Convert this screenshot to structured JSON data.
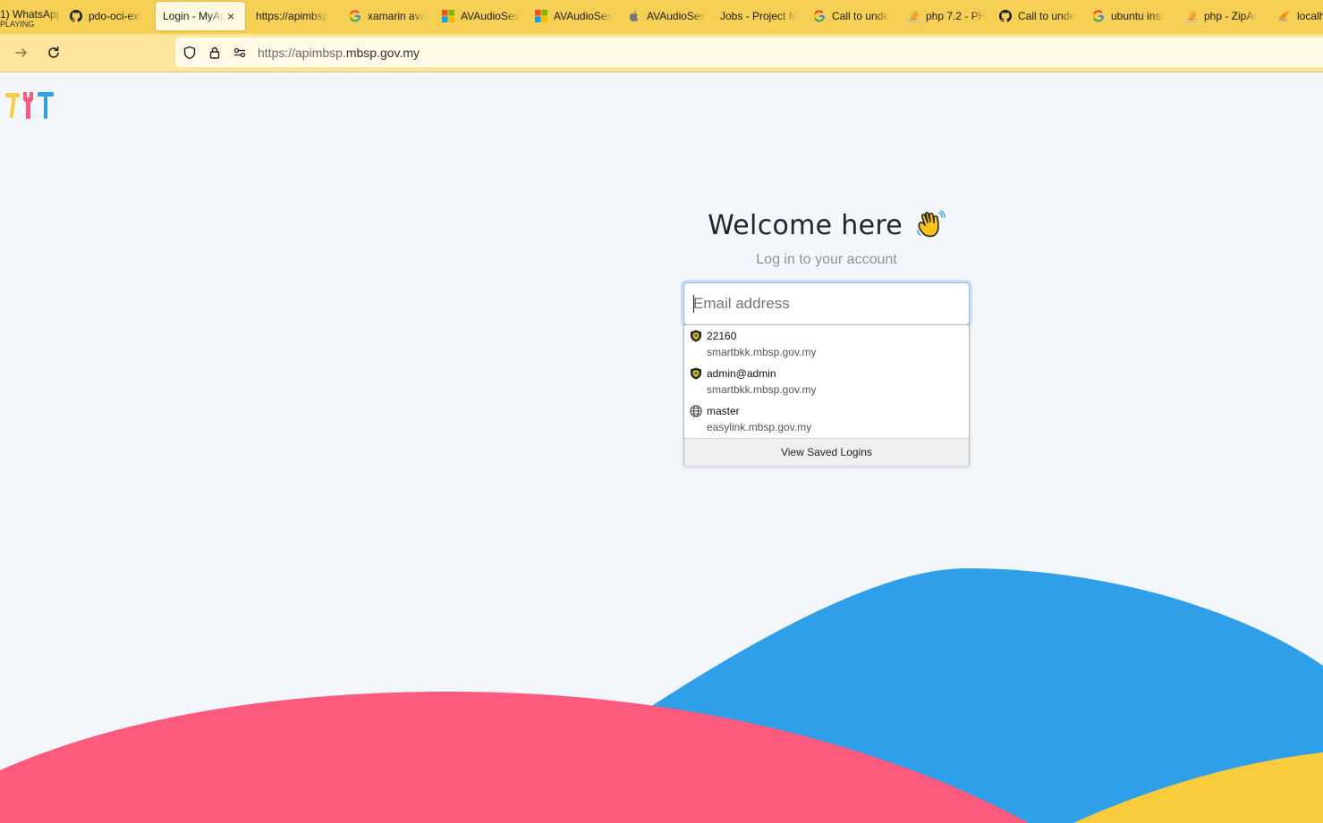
{
  "browser": {
    "tabs": [
      {
        "label": "1) WhatsApp",
        "sub": "PLAYING",
        "icon": "whatsapp-icon"
      },
      {
        "label": "pdo-oci-ext",
        "icon": "github-icon"
      },
      {
        "label": "Login - MyApi",
        "icon": "none",
        "active": true
      },
      {
        "label": "https://apimbsp",
        "icon": "none"
      },
      {
        "label": "xamarin ava",
        "icon": "google-icon"
      },
      {
        "label": "AVAudioSes",
        "icon": "microsoft-icon"
      },
      {
        "label": "AVAudioSes",
        "icon": "microsoft-icon"
      },
      {
        "label": "AVAudioSes",
        "icon": "apple-icon"
      },
      {
        "label": "Jobs - Project M",
        "icon": "none"
      },
      {
        "label": "Call to unde",
        "icon": "google-icon"
      },
      {
        "label": "php 7.2 - PH",
        "icon": "stackoverflow-icon"
      },
      {
        "label": "Call to unde",
        "icon": "github-icon"
      },
      {
        "label": "ubuntu inst",
        "icon": "google-icon"
      },
      {
        "label": "php - ZipAr",
        "icon": "stackoverflow-icon"
      },
      {
        "label": "localh",
        "icon": "phpmyadmin-icon"
      }
    ],
    "close_tab": "×",
    "url": {
      "host_dim": "https://apimbsp.",
      "host_main": "mbsp.gov.my"
    }
  },
  "page": {
    "welcome": "Welcome here",
    "subtitle": "Log in to your account",
    "email_placeholder": "Email address"
  },
  "autocomplete": {
    "items": [
      {
        "user": "22160",
        "site": "smartbkk.mbsp.gov.my",
        "icon": "shield-crest-icon"
      },
      {
        "user": "admin@admin",
        "site": "smartbkk.mbsp.gov.my",
        "icon": "shield-crest-icon"
      },
      {
        "user": "master",
        "site": "easylink.mbsp.gov.my",
        "icon": "globe-icon"
      }
    ],
    "footer": "View Saved Logins"
  },
  "colors": {
    "tabbar": "#f6cf55",
    "navbar": "#fce49a",
    "wave_blue": "#2f9fe9",
    "wave_pink": "#fd5b7e",
    "wave_yellow": "#fbcb3e",
    "background": "#f3f7fb"
  }
}
